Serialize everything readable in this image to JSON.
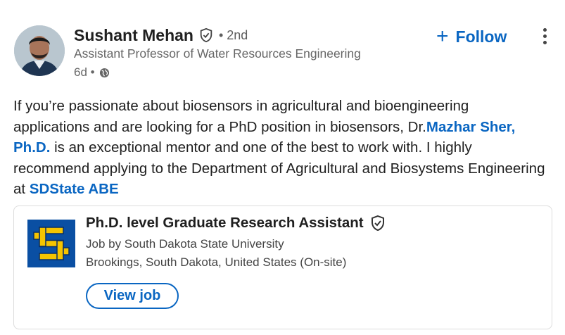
{
  "post": {
    "author": {
      "name": "Sushant Mehan",
      "degree": "• 2nd",
      "headline": "Assistant Professor of Water Resources Engineering",
      "time": "6d •"
    },
    "follow_label": "Follow",
    "follow_plus": "+",
    "text": {
      "part1": "If you’re passionate about biosensors in agricultural and bioengineering applications and are looking for a PhD position in biosensors, Dr.",
      "mention1": "Mazhar Sher, Ph.D.",
      "part2": " is an exceptional mentor and one of the best to work with. I highly recommend applying to the Department of Agricultural and Biosystems Engineering at ",
      "mention2": "SDState ABE"
    },
    "job_card": {
      "title": "Ph.D. level Graduate Research Assistant",
      "company_line": "Job by South Dakota State University",
      "location_line": "Brookings, South Dakota, United States (On-site)",
      "button_label": "View job"
    }
  },
  "colors": {
    "accent": "#0a66c2",
    "logo_blue": "#0a4fa3",
    "logo_yellow": "#f5c400"
  },
  "icons": {
    "verified": "shield-check-icon",
    "visibility": "globe-icon",
    "more": "more-vertical-icon"
  }
}
